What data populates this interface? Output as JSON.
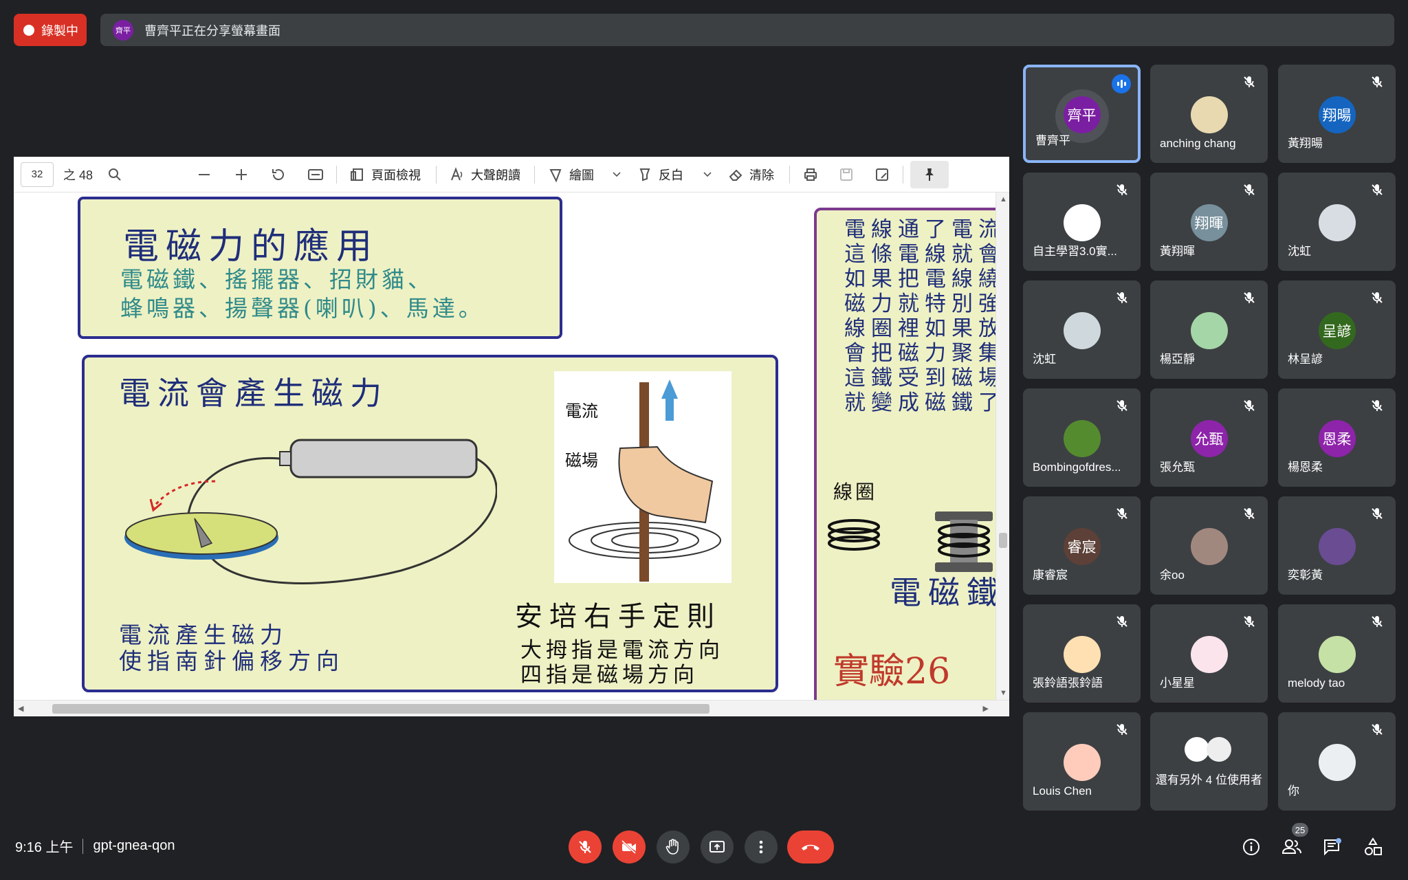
{
  "recording": {
    "label": "錄製中"
  },
  "share": {
    "avatar_text": "齊平",
    "message": "曹齊平正在分享螢幕畫面"
  },
  "viewer": {
    "page_current": "32",
    "page_total": "之 48",
    "page_view_label": "頁面檢視",
    "read_aloud_label": "大聲朗讀",
    "draw_label": "繪圖",
    "highlight_label": "反白",
    "erase_label": "清除"
  },
  "slide": {
    "box1_title": "電磁力的應用",
    "box1_line1": "電磁鐵、搖擺器、招財貓、",
    "box1_line2": "蜂鳴器、揚聲器(喇叭)、馬達。",
    "box2_title": "電流會產生磁力",
    "box2_caption1": "電流產生磁力",
    "box2_caption2": "使指南針偏移方向",
    "figure_current": "電流",
    "figure_field": "磁場",
    "rule_title": "安培右手定則",
    "rule_line1": "大拇指是電流方向",
    "rule_line2": "四指是磁場方向",
    "box3_lines": [
      "電線通了電流",
      "這條電線就會",
      "如果把電線繞",
      "磁力就特別強",
      "線圈裡如果放",
      "會把磁力聚集",
      "這鐵受到磁場",
      "就變成磁鐵了"
    ],
    "coil_label": "線圈",
    "electromagnet_label": "電磁鐵",
    "experiment_label": "實驗26"
  },
  "participants": [
    {
      "name": "曹齊平",
      "avatar_text": "齊平",
      "color": "#7b1fa2",
      "speaking": true
    },
    {
      "name": "anching chang",
      "avatar_text": "",
      "color": "#e8d9b0"
    },
    {
      "name": "黃翔暘",
      "avatar_text": "翔暘",
      "color": "#1565c0"
    },
    {
      "name": "自主學習3.0實...",
      "avatar_text": "",
      "color": "#ffffff"
    },
    {
      "name": "黃翔暉",
      "avatar_text": "翔暉",
      "color": "#78909c"
    },
    {
      "name": "沈虹",
      "avatar_text": "",
      "color": "#d7dde3"
    },
    {
      "name": "沈虹",
      "avatar_text": "",
      "color": "#cfd8dc"
    },
    {
      "name": "楊亞靜",
      "avatar_text": "",
      "color": "#a5d6a7"
    },
    {
      "name": "林呈諺",
      "avatar_text": "呈諺",
      "color": "#33691e"
    },
    {
      "name": "Bombingofdres...",
      "avatar_text": "",
      "color": "#558b2f"
    },
    {
      "name": "張允甄",
      "avatar_text": "允甄",
      "color": "#8e24aa"
    },
    {
      "name": "楊恩柔",
      "avatar_text": "恩柔",
      "color": "#8e24aa"
    },
    {
      "name": "康睿宸",
      "avatar_text": "睿宸",
      "color": "#5d4037"
    },
    {
      "name": "余oo",
      "avatar_text": "",
      "color": "#a1887f"
    },
    {
      "name": "奕彰黃",
      "avatar_text": "",
      "color": "#6a4c93"
    },
    {
      "name": "張鈴語張鈴語",
      "avatar_text": "",
      "color": "#ffe0b2"
    },
    {
      "name": "小星星",
      "avatar_text": "",
      "color": "#fce4ec"
    },
    {
      "name": "melody tao",
      "avatar_text": "",
      "color": "#c5e1a5"
    },
    {
      "name": "Louis Chen",
      "avatar_text": "",
      "color": "#ffccbc"
    },
    {
      "name": "還有另外 4 位使用者",
      "avatar_text": "",
      "color": "#eeeeee",
      "more": true
    },
    {
      "name": "你",
      "avatar_text": "",
      "color": "#eceff1"
    }
  ],
  "footer": {
    "time": "9:16 上午",
    "meeting_code": "gpt-gnea-qon",
    "participant_count": "25"
  },
  "colors": {
    "accent": "#8ab4f8",
    "danger": "#ea4335",
    "tile": "#3c4043"
  }
}
